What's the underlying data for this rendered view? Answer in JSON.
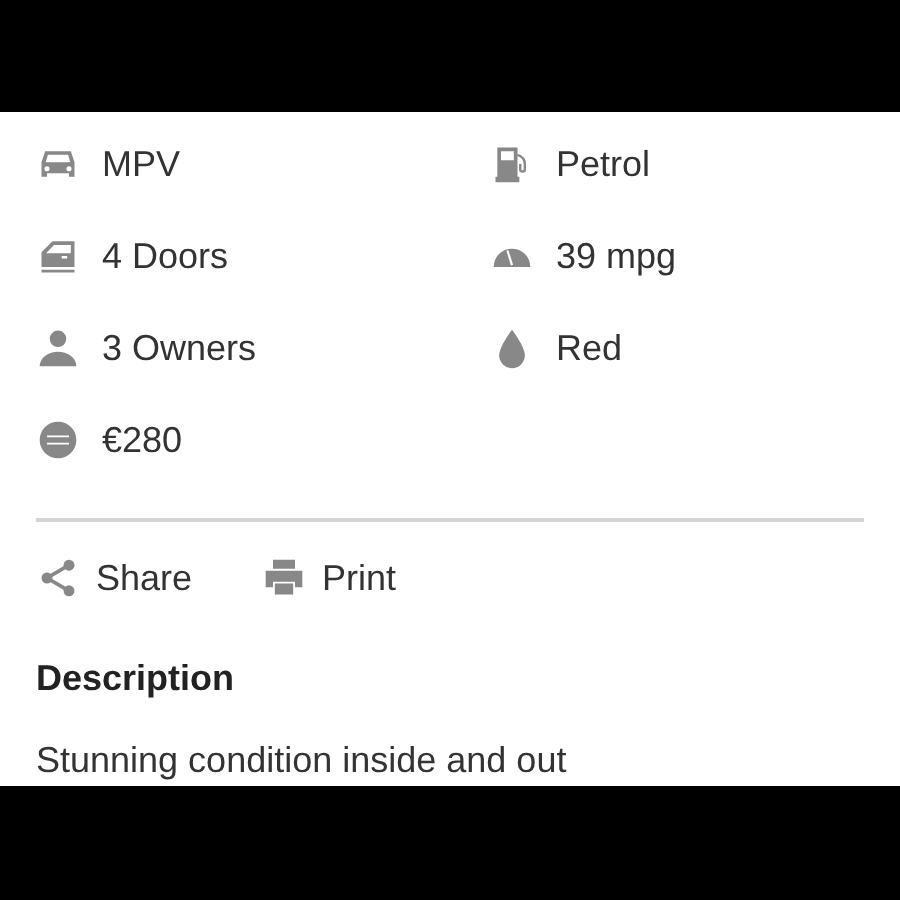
{
  "specs": [
    {
      "kind": "car",
      "label": "MPV"
    },
    {
      "kind": "fuel",
      "label": "Petrol"
    },
    {
      "kind": "door",
      "label": "4 Doors"
    },
    {
      "kind": "gauge",
      "label": "39 mpg"
    },
    {
      "kind": "person",
      "label": "3 Owners"
    },
    {
      "kind": "drop",
      "label": "Red"
    },
    {
      "kind": "tax",
      "label": "€280"
    }
  ],
  "actions": [
    {
      "kind": "share",
      "label": "Share"
    },
    {
      "kind": "print",
      "label": "Print"
    }
  ],
  "description": {
    "heading": "Description",
    "text": "Stunning condition inside and out"
  }
}
